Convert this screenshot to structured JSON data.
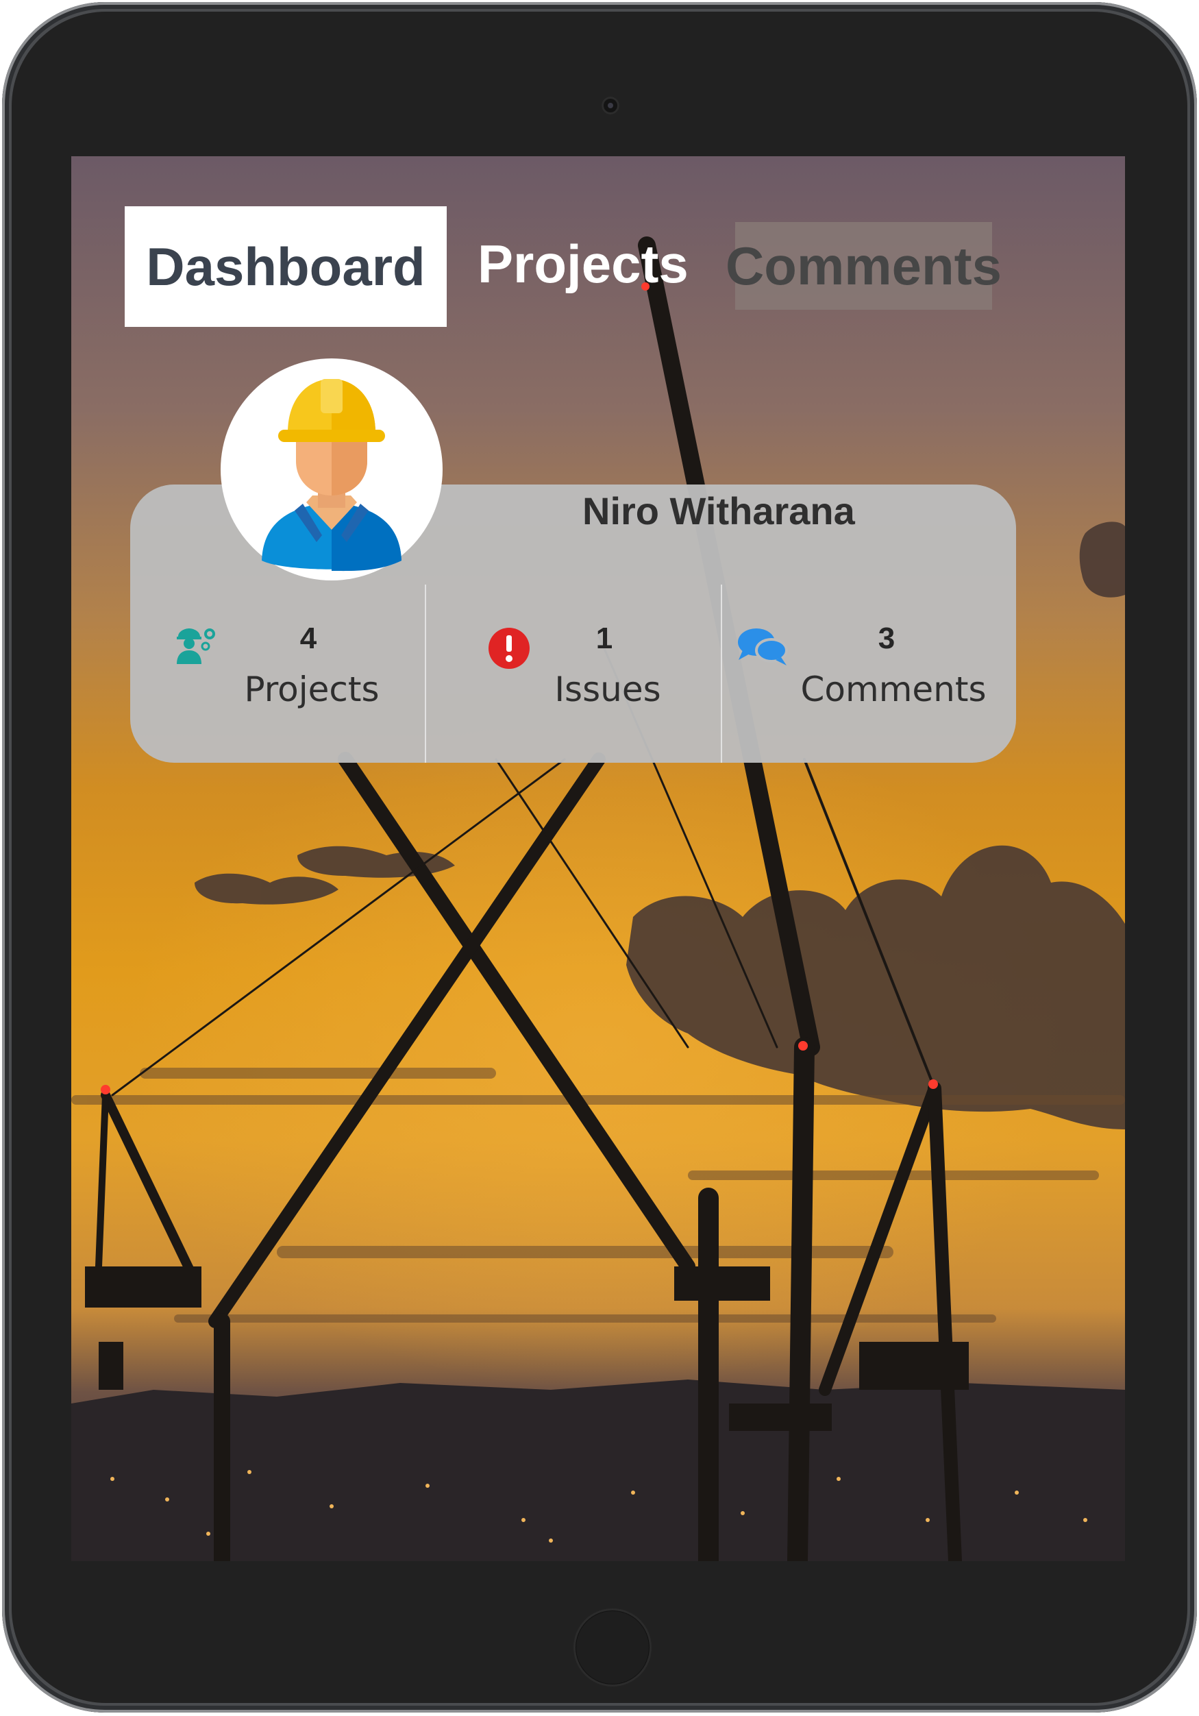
{
  "tabs": [
    {
      "label": "Dashboard"
    },
    {
      "label": "Projects"
    },
    {
      "label": "Comments"
    }
  ],
  "profile": {
    "name": "Niro Witharana",
    "avatar_icon": "construction-worker-avatar"
  },
  "stats": [
    {
      "count": "4",
      "label": "Projects",
      "icon": "worker-gear-icon",
      "color": "#1aa39a"
    },
    {
      "count": "1",
      "label": "Issues",
      "icon": "exclamation-circle-icon",
      "color": "#e02424"
    },
    {
      "count": "3",
      "label": "Comments",
      "icon": "comments-icon",
      "color": "#2b8fe8"
    }
  ],
  "colors": {
    "active_tab_bg": "#ffffff",
    "active_tab_text": "#3b434f",
    "card_bg": "#bcbcbc",
    "device_bezel": "#212121"
  }
}
